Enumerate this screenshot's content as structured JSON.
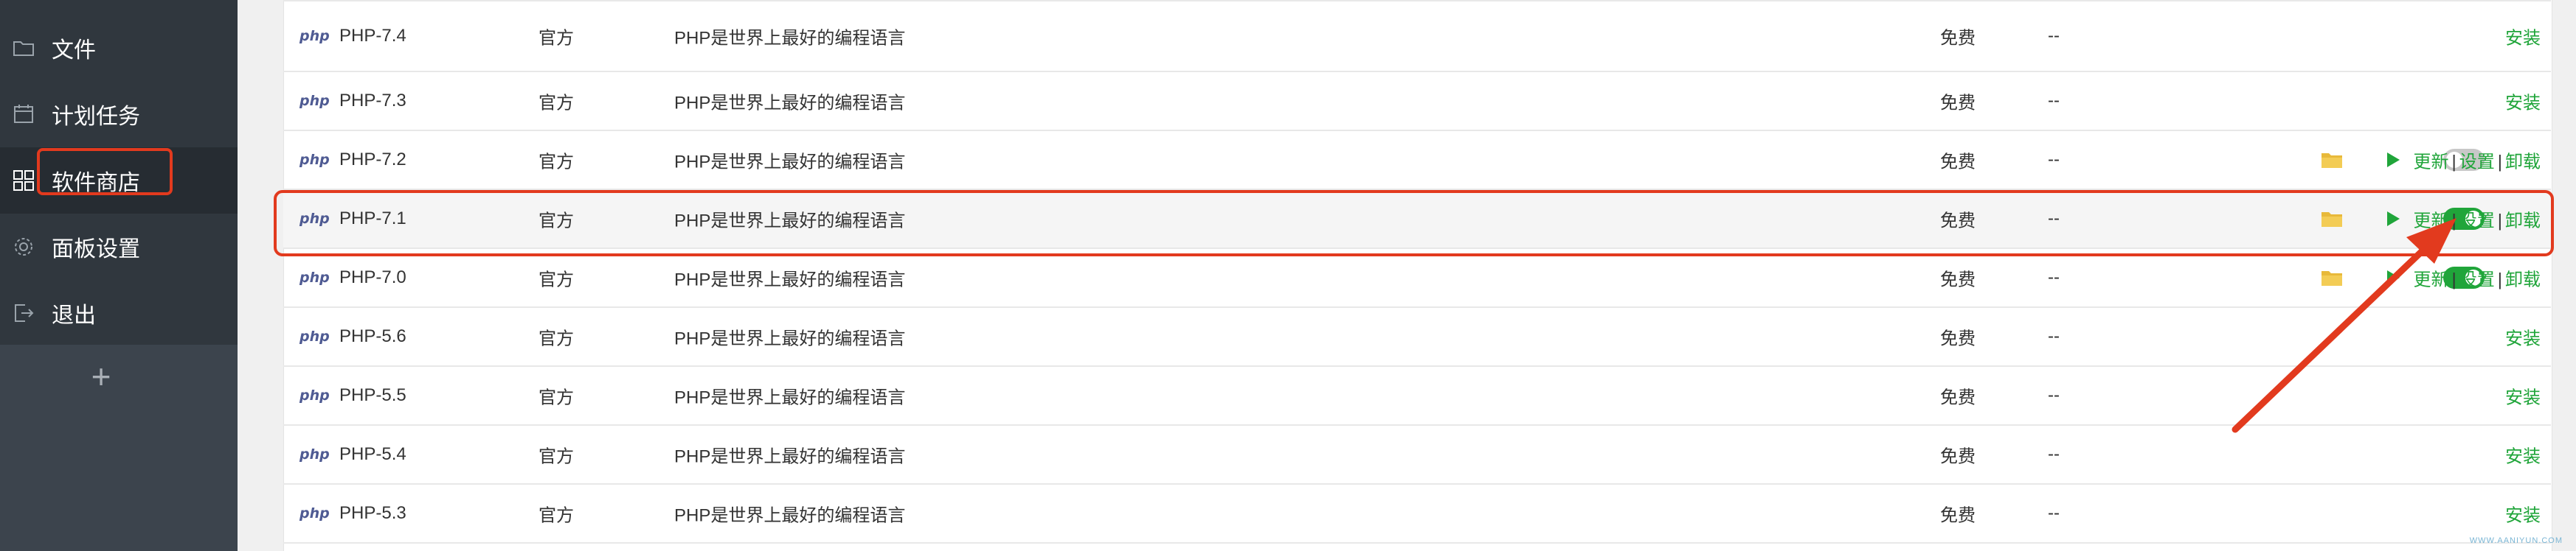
{
  "sidebar": {
    "items": [
      {
        "label": "文件",
        "icon": "folder-icon"
      },
      {
        "label": "计划任务",
        "icon": "calendar-icon"
      },
      {
        "label": "软件商店",
        "icon": "grid-icon",
        "active": true
      },
      {
        "label": "面板设置",
        "icon": "gear-icon"
      },
      {
        "label": "退出",
        "icon": "logout-icon"
      }
    ],
    "add_label": "+"
  },
  "table": {
    "rows": [
      {
        "logo": "php",
        "name": "PHP-7.4",
        "type": "官方",
        "desc": "PHP是世界上最好的编程语言",
        "price": "免费",
        "expire": "--",
        "installed": false,
        "action": "安装"
      },
      {
        "logo": "php",
        "name": "PHP-7.3",
        "type": "官方",
        "desc": "PHP是世界上最好的编程语言",
        "price": "免费",
        "expire": "--",
        "installed": false,
        "action": "安装"
      },
      {
        "logo": "php",
        "name": "PHP-7.2",
        "type": "官方",
        "desc": "PHP是世界上最好的编程语言",
        "price": "免费",
        "expire": "--",
        "installed": true,
        "running": false,
        "action_update": "更新",
        "action_settings": "设置",
        "action_uninstall": "卸载",
        "sep": "|"
      },
      {
        "logo": "php",
        "name": "PHP-7.1",
        "type": "官方",
        "desc": "PHP是世界上最好的编程语言",
        "price": "免费",
        "expire": "--",
        "installed": true,
        "running": true,
        "action_update": "更新",
        "action_settings": "设置",
        "action_uninstall": "卸载",
        "sep": "|"
      },
      {
        "logo": "php",
        "name": "PHP-7.0",
        "type": "官方",
        "desc": "PHP是世界上最好的编程语言",
        "price": "免费",
        "expire": "--",
        "installed": true,
        "running": true,
        "action_update": "更新",
        "action_settings": "设置",
        "action_uninstall": "卸载",
        "sep": "|"
      },
      {
        "logo": "php",
        "name": "PHP-5.6",
        "type": "官方",
        "desc": "PHP是世界上最好的编程语言",
        "price": "免费",
        "expire": "--",
        "installed": false,
        "action": "安装"
      },
      {
        "logo": "php",
        "name": "PHP-5.5",
        "type": "官方",
        "desc": "PHP是世界上最好的编程语言",
        "price": "免费",
        "expire": "--",
        "installed": false,
        "action": "安装"
      },
      {
        "logo": "php",
        "name": "PHP-5.4",
        "type": "官方",
        "desc": "PHP是世界上最好的编程语言",
        "price": "免费",
        "expire": "--",
        "installed": false,
        "action": "安装"
      },
      {
        "logo": "php",
        "name": "PHP-5.3",
        "type": "官方",
        "desc": "PHP是世界上最好的编程语言",
        "price": "免费",
        "expire": "--",
        "installed": false,
        "action": "安装"
      }
    ]
  },
  "colors": {
    "sidebar_bg": "#30373e",
    "sidebar_active": "#262c32",
    "accent_green": "#20a53a",
    "highlight_red": "#e23a1e",
    "toggle_off": "#c8c8c8"
  },
  "watermark": "WWW.AANIYUN.COM"
}
